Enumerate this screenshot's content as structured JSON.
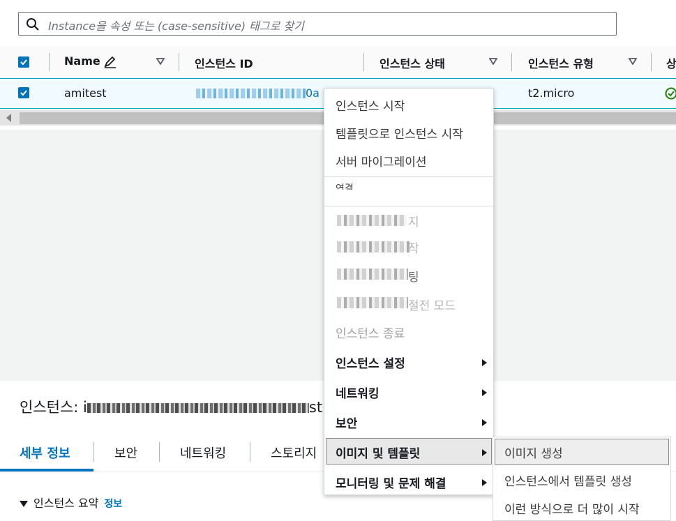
{
  "search": {
    "placeholder": "Instance을 속성 또는 (case-sensitive) 태그로 찾기"
  },
  "table": {
    "columns": [
      {
        "label": "Name"
      },
      {
        "label": "인스턴스 ID"
      },
      {
        "label": "인스턴스 상태"
      },
      {
        "label": "인스턴스 유형"
      },
      {
        "label": "상"
      }
    ],
    "rows": [
      {
        "name": "amitest",
        "instance_id_suffix": "0a",
        "instance_type": "t2.micro"
      }
    ]
  },
  "context_menu": {
    "items": [
      {
        "label": "인스턴스 시작"
      },
      {
        "label": "템플릿으로 인스턴스 시작"
      },
      {
        "label": "서버 마이그레이션"
      },
      {
        "label": "연결"
      },
      {
        "label": "지"
      },
      {
        "label": "작"
      },
      {
        "label": "팅"
      },
      {
        "label": "절전 모드"
      },
      {
        "label": "인스턴스 종료"
      },
      {
        "label": "인스턴스 설정"
      },
      {
        "label": "네트워킹"
      },
      {
        "label": "보안"
      },
      {
        "label": "이미지 및 템플릿"
      },
      {
        "label": "모니터링 및 문제 해결"
      }
    ]
  },
  "submenu": {
    "items": [
      {
        "label": "이미지 생성"
      },
      {
        "label": "인스턴스에서 템플릿 생성"
      },
      {
        "label": "이런 방식으로 더 많이 시작"
      }
    ]
  },
  "details": {
    "title_prefix": "인스턴스: i",
    "title_suffix": "st",
    "tabs": [
      {
        "label": "세부 정보"
      },
      {
        "label": "보안"
      },
      {
        "label": "네트워킹"
      },
      {
        "label": "스토리지"
      }
    ],
    "summary_label": "인스턴스 요약",
    "info_link": "정보"
  },
  "colors": {
    "accent": "#0073bb",
    "status_green": "#1d8102"
  }
}
